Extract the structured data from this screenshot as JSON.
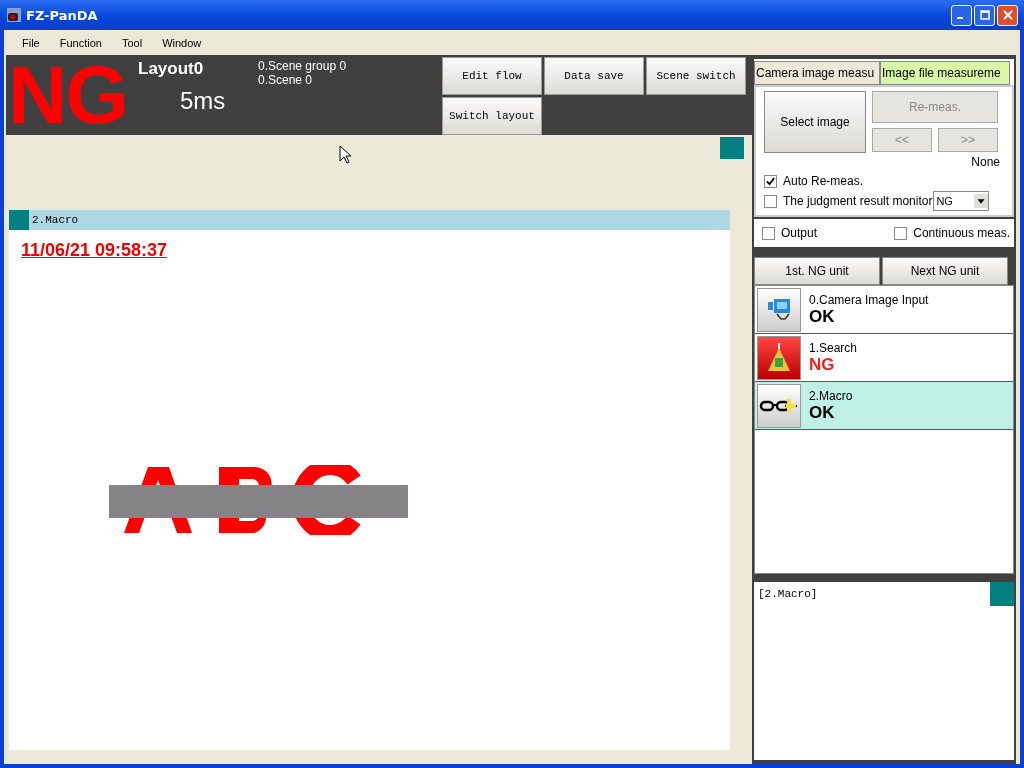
{
  "window": {
    "title": "FZ-PanDA"
  },
  "menu": [
    "File",
    "Function",
    "Tool",
    "Window"
  ],
  "header": {
    "judgement": "NG",
    "layout": "Layout0",
    "scene_group": "0.Scene group 0",
    "scene": "0.Scene 0",
    "time": "5ms"
  },
  "toolbar_buttons": [
    "Edit flow",
    "Data save",
    "Scene switch",
    "Switch layout"
  ],
  "image_pane": {
    "title": "2.Macro",
    "timestamp": "11/06/21 09:58:37",
    "kind": "picture"
  },
  "measure_tabs": [
    {
      "label": "Camera image measu",
      "selected": false
    },
    {
      "label": "Image file measureme",
      "selected": true
    }
  ],
  "select_image": "Select image",
  "nav_buttons": [
    {
      "label": "Re-meas.",
      "disabled": true
    },
    {
      "label": "<<",
      "disabled": true
    },
    {
      "label": ">>",
      "disabled": true
    }
  ],
  "file_name": "None",
  "checks": [
    {
      "label": "Auto Re-meas.",
      "checked": true
    },
    {
      "label": "The judgment result monitor",
      "checked": false
    }
  ],
  "monitor_select": "NG",
  "output_options": [
    {
      "label": "Output",
      "checked": false
    },
    {
      "label": "Continuous meas.",
      "checked": false
    }
  ],
  "ng_buttons": [
    "1st. NG unit",
    "Next NG unit"
  ],
  "flow": [
    {
      "name": "0.Camera Image Input",
      "result": "OK",
      "failed": false,
      "kind": "camera",
      "selected": false
    },
    {
      "name": "1.Search",
      "result": "NG",
      "failed": true,
      "kind": "search",
      "selected": false
    },
    {
      "name": "2.Macro",
      "result": "OK",
      "failed": false,
      "kind": "macro",
      "selected": true
    }
  ],
  "detail_pane": {
    "title": "[2.Macro]"
  }
}
